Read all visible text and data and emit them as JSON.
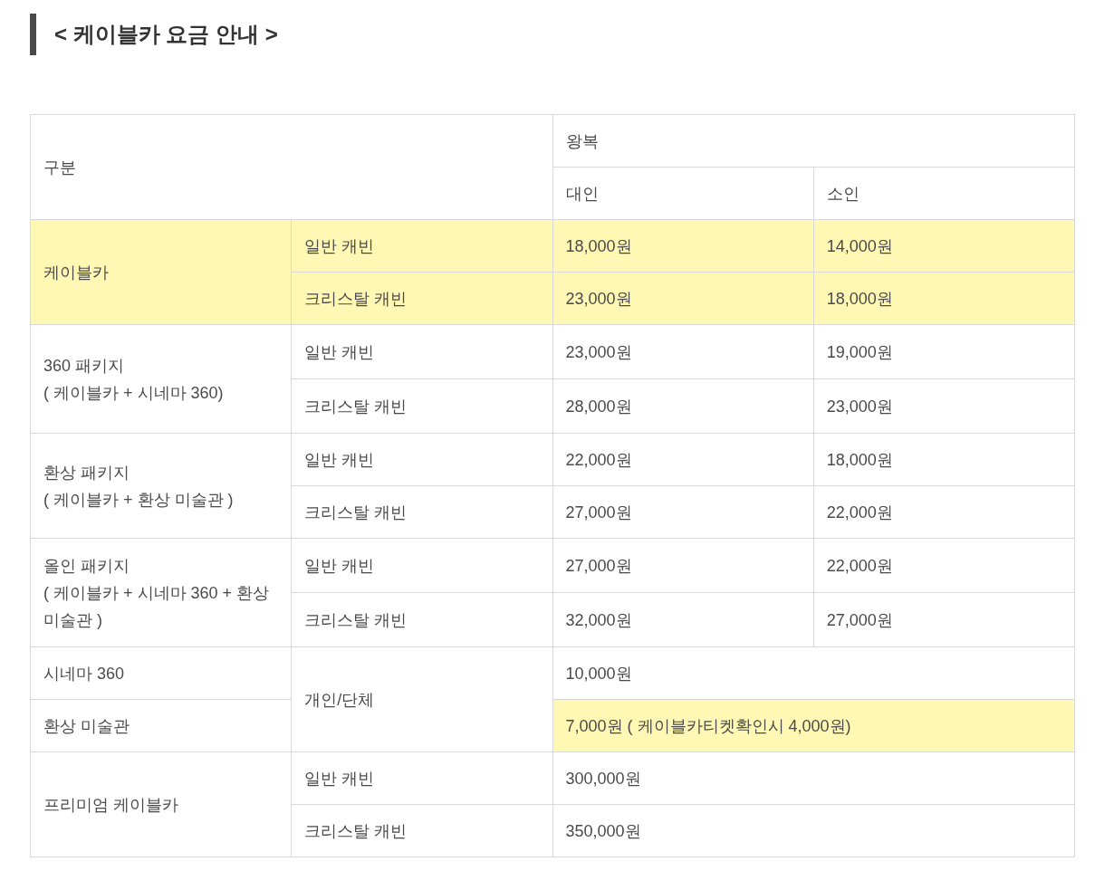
{
  "title": "< 케이블카 요금 안내 >",
  "header": {
    "category": "구분",
    "trip": "왕복",
    "columns": [
      "대인",
      "소인"
    ]
  },
  "groups": [
    {
      "kind": "split",
      "name": "케이블카",
      "highlighted": true,
      "cabins": [
        {
          "label": "일반 캐빈",
          "adult": "18,000원",
          "child": "14,000원"
        },
        {
          "label": "크리스탈 캐빈",
          "adult": "23,000원",
          "child": "18,000원"
        }
      ]
    },
    {
      "kind": "split",
      "name": "360 패키지\n ( 케이블카 + 시네마 360)",
      "highlighted": false,
      "cabins": [
        {
          "label": "일반 캐빈",
          "adult": "23,000원",
          "child": "19,000원"
        },
        {
          "label": "크리스탈 캐빈",
          "adult": "28,000원",
          "child": "23,000원"
        }
      ]
    },
    {
      "kind": "split",
      "name": "환상 패키지\n( 케이블카 + 환상 미술관 )",
      "highlighted": false,
      "cabins": [
        {
          "label": "일반 캐빈",
          "adult": "22,000원",
          "child": "18,000원"
        },
        {
          "label": "크리스탈 캐빈",
          "adult": "27,000원",
          "child": "22,000원"
        }
      ]
    },
    {
      "kind": "split",
      "name": "올인 패키지\n( 케이블카 + 시네마 360 + 환상 미술관 )",
      "highlighted": false,
      "cabins": [
        {
          "label": "일반 캐빈",
          "adult": "27,000원",
          "child": "22,000원"
        },
        {
          "label": "크리스탈 캐빈",
          "adult": "32,000원",
          "child": "27,000원"
        }
      ]
    },
    {
      "kind": "shared",
      "label": "개인/단체",
      "items": [
        {
          "name": "시네마 360",
          "price": "10,000원",
          "highlighted": false
        },
        {
          "name": "환상 미술관",
          "price": "7,000원 ( 케이블카티켓확인시 4,000원)",
          "highlighted": true
        }
      ]
    },
    {
      "kind": "single",
      "name": "프리미엄 케이블카",
      "cabins": [
        {
          "label": "일반 캐빈",
          "price": "300,000원"
        },
        {
          "label": "크리스탈 캐빈",
          "price": "350,000원"
        }
      ]
    }
  ]
}
